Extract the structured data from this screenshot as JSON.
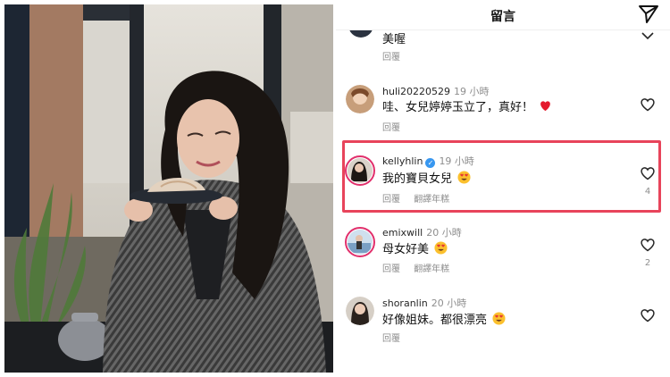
{
  "header": {
    "title": "留言",
    "send_icon": "send-icon"
  },
  "comments": [
    {
      "username": "",
      "time": "",
      "text": "美喔",
      "reply": "回覆",
      "translate": "",
      "likes": ""
    },
    {
      "username": "huli20220529",
      "time": "19 小時",
      "text": "哇、女兒婷婷玉立了，真好！",
      "emoji": "red-heart-icon",
      "reply": "回覆",
      "translate": "",
      "likes": ""
    },
    {
      "username": "kellyhlin",
      "time": "19 小時",
      "verified": true,
      "text": "我的寶貝女兒",
      "emoji": "heart-eyes-emoji",
      "reply": "回覆",
      "translate": "翻譯年糕",
      "likes": "4"
    },
    {
      "username": "emixwill",
      "time": "20 小時",
      "text": "母女好美",
      "emoji": "heart-eyes-emoji",
      "reply": "回覆",
      "translate": "翻譯年糕",
      "likes": "2"
    },
    {
      "username": "shoranlin",
      "time": "20 小時",
      "text": "好像姐妹。都很漂亮",
      "emoji": "heart-eyes-emoji",
      "reply": "回覆",
      "translate": "",
      "likes": ""
    }
  ],
  "colors": {
    "highlight": "#e8445b",
    "verified": "#3897f0",
    "story_ring": "#e1306c",
    "muted": "#8e8e8e"
  }
}
